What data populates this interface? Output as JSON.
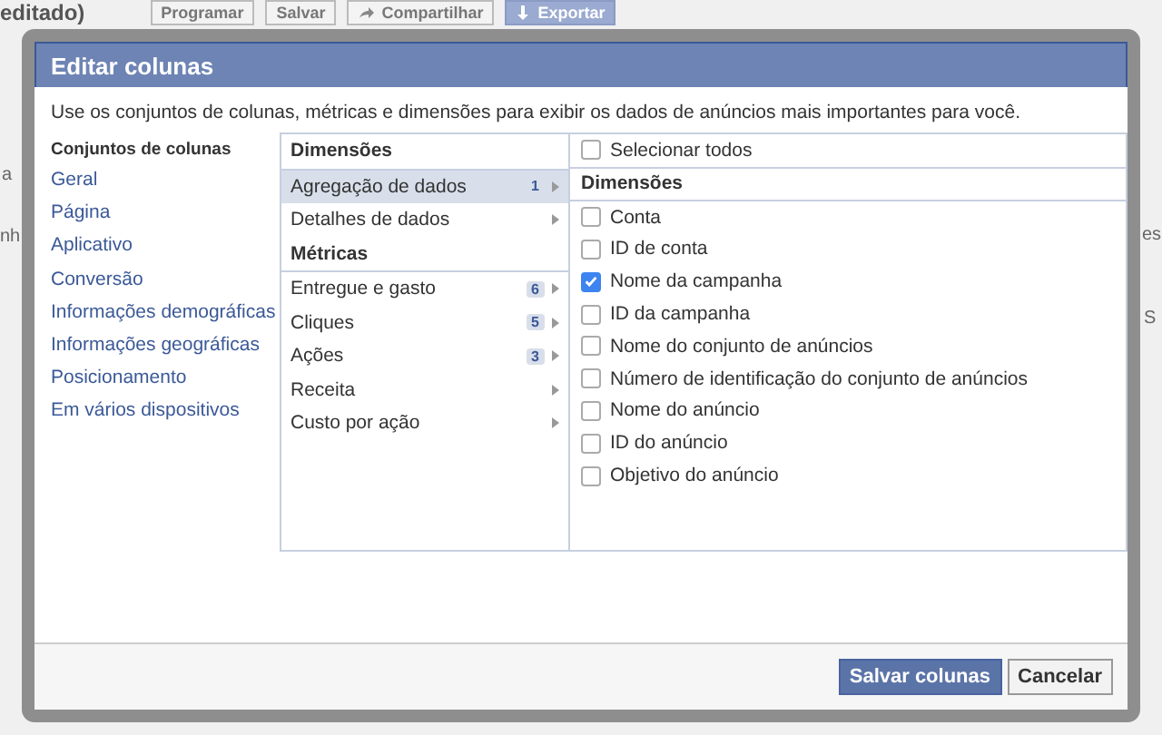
{
  "background": {
    "title": "editado)",
    "buttons": [
      {
        "label": "Programar",
        "kind": "plain"
      },
      {
        "label": "Salvar",
        "kind": "plain"
      },
      {
        "label": "Compartilhar",
        "kind": "share"
      },
      {
        "label": "Exportar",
        "kind": "export"
      }
    ],
    "fragments": [
      "a",
      "nh",
      "es",
      "S"
    ]
  },
  "dialog": {
    "title": "Editar colunas",
    "description": "Use os conjuntos de colunas, métricas e dimensões para exibir os dados de anúncios mais importantes para você.",
    "column_sets": {
      "heading": "Conjuntos de colunas",
      "items": [
        "Geral",
        "Página",
        "Aplicativo",
        "Conversão",
        "Informações demográficas",
        "Informações geográficas",
        "Posicionamento",
        "Em vários dispositivos"
      ]
    },
    "categories": [
      {
        "kind": "header",
        "label": "Dimensões"
      },
      {
        "kind": "item",
        "label": "Agregação de dados",
        "count": "1",
        "selected": true
      },
      {
        "kind": "item",
        "label": "Detalhes de dados",
        "selected": false
      },
      {
        "kind": "header",
        "label": "Métricas"
      },
      {
        "kind": "item",
        "label": "Entregue e gasto",
        "count": "6",
        "selected": false
      },
      {
        "kind": "item",
        "label": "Cliques",
        "count": "5",
        "selected": false
      },
      {
        "kind": "item",
        "label": "Ações",
        "count": "3",
        "selected": false
      },
      {
        "kind": "item",
        "label": "Receita",
        "selected": false
      },
      {
        "kind": "item",
        "label": "Custo por ação",
        "selected": false
      }
    ],
    "select_all": {
      "label": "Selecionar todos",
      "checked": false
    },
    "section": "Dimensões",
    "options": [
      {
        "label": "Conta",
        "checked": false
      },
      {
        "label": "ID de conta",
        "checked": false
      },
      {
        "label": "Nome da campanha",
        "checked": true
      },
      {
        "label": "ID da campanha",
        "checked": false
      },
      {
        "label": "Nome do conjunto de anúncios",
        "checked": false
      },
      {
        "label": "Número de identificação do conjunto de anúncios",
        "checked": false
      },
      {
        "label": "Nome do anúncio",
        "checked": false
      },
      {
        "label": "ID do anúncio",
        "checked": false
      },
      {
        "label": "Objetivo do anúncio",
        "checked": false
      }
    ],
    "buttons": [
      {
        "label": "Salvar colunas",
        "kind": "primary"
      },
      {
        "label": "Cancelar",
        "kind": "secondary"
      }
    ]
  }
}
